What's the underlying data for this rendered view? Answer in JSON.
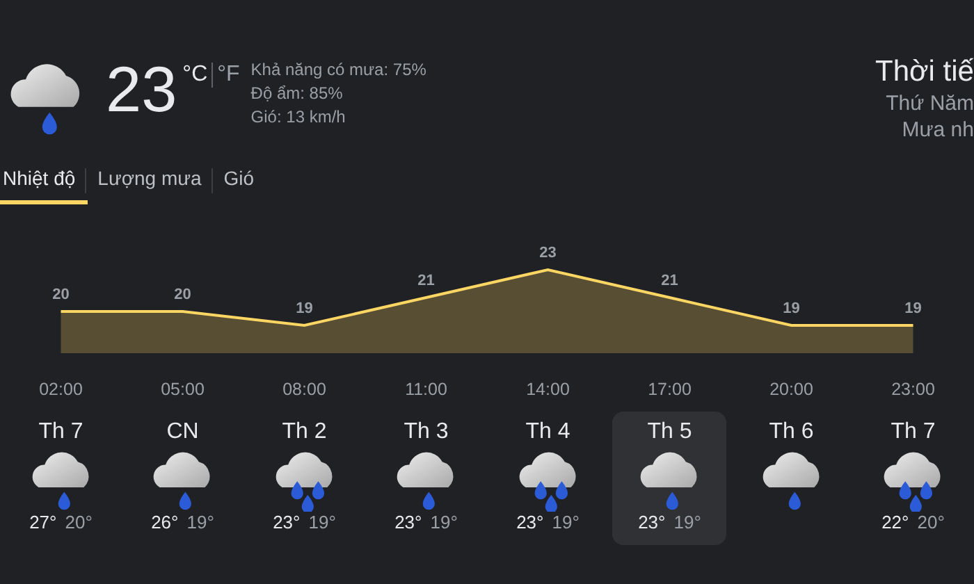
{
  "current": {
    "temperature": "23",
    "units": [
      {
        "label": "°C",
        "selected": true
      },
      {
        "label": "°F",
        "selected": false
      }
    ],
    "details": [
      "Khả năng có mưa: 75%",
      "Độ ẩm: 85%",
      "Gió: 13 km/h"
    ]
  },
  "heading": {
    "title": "Thời tiế",
    "day": "Thứ Năm",
    "condition": "Mưa nh"
  },
  "tabs": [
    {
      "label": "Nhiệt độ",
      "selected": true
    },
    {
      "label": "Lượng mưa",
      "selected": false
    },
    {
      "label": "Gió",
      "selected": false
    }
  ],
  "chart_data": {
    "type": "area",
    "categories": [
      "02:00",
      "05:00",
      "08:00",
      "11:00",
      "14:00",
      "17:00",
      "20:00",
      "23:00"
    ],
    "series": [
      {
        "color": "#fdd663",
        "values": [
          20,
          20,
          19,
          21,
          23,
          21,
          19,
          19
        ]
      }
    ],
    "data_labels": true
  },
  "days": [
    {
      "label": "Th 7",
      "kind": "light",
      "high": "27°",
      "low": "20°",
      "selected": false
    },
    {
      "label": "CN",
      "kind": "light",
      "high": "26°",
      "low": "19°",
      "selected": false
    },
    {
      "label": "Th 2",
      "kind": "heavy",
      "high": "23°",
      "low": "19°",
      "selected": false
    },
    {
      "label": "Th 3",
      "kind": "light",
      "high": "23°",
      "low": "19°",
      "selected": false
    },
    {
      "label": "Th 4",
      "kind": "heavy",
      "high": "23°",
      "low": "19°",
      "selected": false
    },
    {
      "label": "Th 5",
      "kind": "light",
      "high": "23°",
      "low": "19°",
      "selected": true
    },
    {
      "label": "Th 6",
      "kind": "light",
      "selected": false
    },
    {
      "label": "Th 7",
      "kind": "heavy",
      "high": "22°",
      "low": "20°",
      "selected": false
    }
  ]
}
